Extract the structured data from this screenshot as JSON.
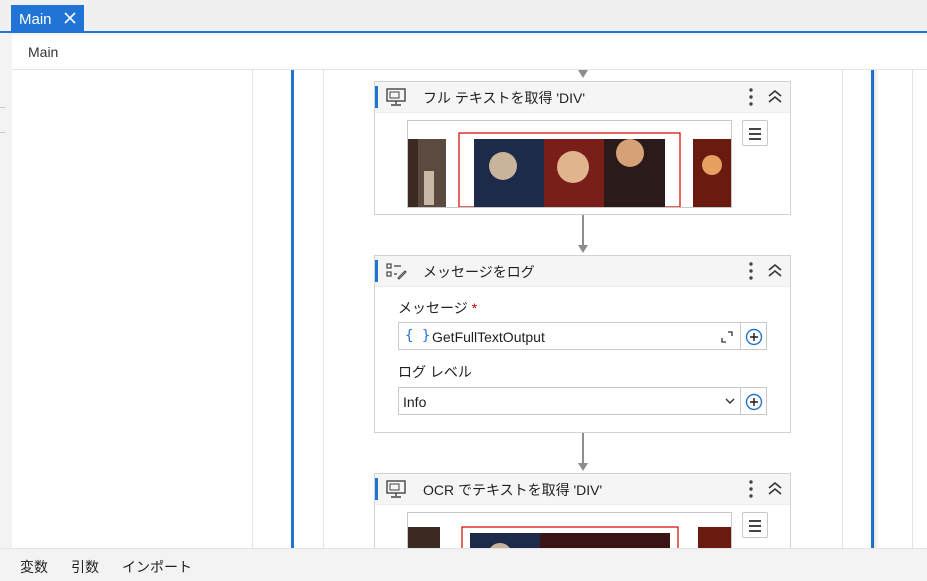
{
  "tab": {
    "label": "Main",
    "close_icon": "close-icon"
  },
  "breadcrumb": "Main",
  "activities": [
    {
      "title": "フル テキストを取得 'DIV'",
      "icon": "monitor-icon"
    },
    {
      "title": "メッセージをログ",
      "icon": "log-message-icon",
      "message_label": "メッセージ",
      "required_mark": "*",
      "message_expr_icon": "{ }",
      "message_value": "GetFullTextOutput",
      "log_level_label": "ログ レベル",
      "log_level_value": "Info"
    },
    {
      "title": "OCR でテキストを取得 'DIV'",
      "icon": "monitor-icon"
    }
  ],
  "status_tabs": [
    "変数",
    "引数",
    "インポート"
  ],
  "colors": {
    "accent": "#1f74d6",
    "connector": "#8d8d8d",
    "required": "#cc0000"
  }
}
